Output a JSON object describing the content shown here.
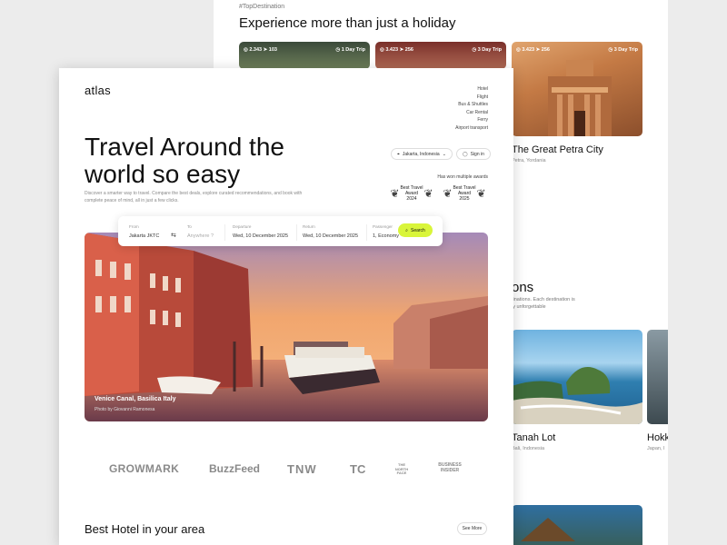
{
  "back_page": {
    "tag": "#TopDestination",
    "heading": "Experience more than just a holiday",
    "cards": [
      {
        "views": "2.343",
        "shares": "103",
        "trip": "1 Day Trip"
      },
      {
        "views": "3.423",
        "shares": "256",
        "trip": "3 Day Trip"
      },
      {
        "views": "3.423",
        "shares": "256",
        "trip": "3 Day Trip",
        "name": "The Great Petra City",
        "location": "Petra, Yordania"
      }
    ],
    "section_partial": "ons",
    "section_desc_lines": [
      "tinations. Each destination is",
      "ly unforgettable"
    ],
    "destinations": [
      {
        "name": "Tanah Lot",
        "location": "Bali, Indonesia"
      },
      {
        "name": "Hokk",
        "location": "Japan, I"
      }
    ]
  },
  "front_page": {
    "logo": "atlas",
    "nav": [
      "Hotel",
      "Flight",
      "Bus & Shuttles",
      "Car Rental",
      "Ferry",
      "Airport transport"
    ],
    "hero_title": "Travel Around the world so easy",
    "intro": "Discover a smarter way to travel. Compare the best deals, explore curated recommendations, and book with complete peace of mind, all in just a few clicks.",
    "location_label": "Jakarta, Indonesia",
    "signin_label": "Sign in",
    "awards_title": "Has won multiple awards",
    "awards": [
      {
        "line1": "Best Travel",
        "line2": "Award",
        "year": "2024"
      },
      {
        "line1": "Best Travel",
        "line2": "Award",
        "year": "2025"
      }
    ],
    "search": {
      "from_label": "From",
      "from_value": "Jakarta JKTC",
      "to_label": "To",
      "to_placeholder": "Anywhere ?",
      "departure_label": "Departure",
      "departure_value": "Wed, 10 December 2025",
      "return_label": "Return",
      "return_value": "Wed, 10 December 2025",
      "passenger_label": "Passenger",
      "passenger_value": "1, Economy",
      "button": "Search"
    },
    "photo": {
      "caption": "Venice Canal, Basilica Italy",
      "credit": "Photo by Giovanni Ramonesa"
    },
    "brands": [
      "GROWMARK",
      "BuzzFeed",
      "TNW",
      "TC",
      "THE NORTH FACE",
      "BUSINESS INSIDER"
    ],
    "hotel_heading": "Best Hotel in your area",
    "see_more": "See More"
  },
  "colors": {
    "accent": "#d9f53a",
    "background": "#ececec"
  }
}
